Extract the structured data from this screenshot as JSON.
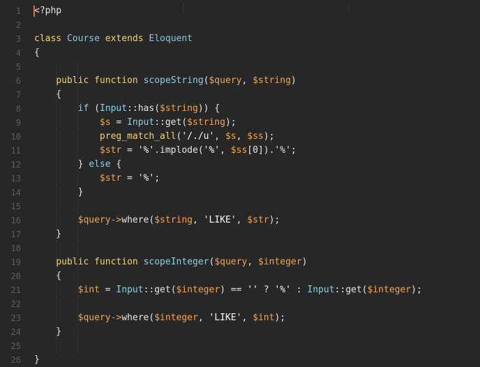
{
  "editor": {
    "language": "php",
    "theme": {
      "background": "#272727",
      "gutter_text": "#5d5d5d",
      "cursor": "#e66a3f"
    },
    "lines": [
      {
        "n": "1",
        "tokens": [
          [
            "tag",
            "<?php"
          ]
        ]
      },
      {
        "n": "2",
        "tokens": []
      },
      {
        "n": "3",
        "tokens": [
          [
            "kw",
            "class"
          ],
          [
            "plain",
            " "
          ],
          [
            "cls",
            "Course"
          ],
          [
            "plain",
            " "
          ],
          [
            "kw",
            "extends"
          ],
          [
            "plain",
            " "
          ],
          [
            "cls",
            "Eloquent"
          ]
        ]
      },
      {
        "n": "4",
        "tokens": [
          [
            "plain",
            "{"
          ]
        ]
      },
      {
        "n": "5",
        "tokens": []
      },
      {
        "n": "6",
        "tokens": [
          [
            "plain",
            "    "
          ],
          [
            "kw",
            "public"
          ],
          [
            "plain",
            " "
          ],
          [
            "kw",
            "function"
          ],
          [
            "plain",
            " "
          ],
          [
            "fn",
            "scopeString"
          ],
          [
            "plain",
            "("
          ],
          [
            "var",
            "$query"
          ],
          [
            "plain",
            ", "
          ],
          [
            "var",
            "$string"
          ],
          [
            "plain",
            ")"
          ]
        ]
      },
      {
        "n": "7",
        "tokens": [
          [
            "plain",
            "    {"
          ]
        ]
      },
      {
        "n": "8",
        "tokens": [
          [
            "plain",
            "        "
          ],
          [
            "ctrl",
            "if"
          ],
          [
            "plain",
            " ("
          ],
          [
            "static",
            "Input"
          ],
          [
            "op",
            "::"
          ],
          [
            "plain",
            "has("
          ],
          [
            "var",
            "$string"
          ],
          [
            "plain",
            ")) {"
          ]
        ]
      },
      {
        "n": "9",
        "tokens": [
          [
            "plain",
            "            "
          ],
          [
            "var",
            "$s"
          ],
          [
            "plain",
            " = "
          ],
          [
            "static",
            "Input"
          ],
          [
            "op",
            "::"
          ],
          [
            "plain",
            "get("
          ],
          [
            "var",
            "$string"
          ],
          [
            "plain",
            ");"
          ]
        ]
      },
      {
        "n": "10",
        "tokens": [
          [
            "plain",
            "            "
          ],
          [
            "kw",
            "preg_match_all"
          ],
          [
            "plain",
            "("
          ],
          [
            "str",
            "'/./u'"
          ],
          [
            "plain",
            ", "
          ],
          [
            "var",
            "$s"
          ],
          [
            "plain",
            ", "
          ],
          [
            "var",
            "$ss"
          ],
          [
            "plain",
            ");"
          ]
        ]
      },
      {
        "n": "11",
        "tokens": [
          [
            "plain",
            "            "
          ],
          [
            "var",
            "$str"
          ],
          [
            "plain",
            " = "
          ],
          [
            "str",
            "'%'"
          ],
          [
            "plain",
            ".implode("
          ],
          [
            "str",
            "'%'"
          ],
          [
            "plain",
            ", "
          ],
          [
            "var",
            "$ss"
          ],
          [
            "plain",
            "[0]).'%';"
          ]
        ]
      },
      {
        "n": "12",
        "tokens": [
          [
            "plain",
            "        } "
          ],
          [
            "ctrl",
            "else"
          ],
          [
            "plain",
            " {"
          ]
        ]
      },
      {
        "n": "13",
        "tokens": [
          [
            "plain",
            "            "
          ],
          [
            "var",
            "$str"
          ],
          [
            "plain",
            " = "
          ],
          [
            "str",
            "'%'"
          ],
          [
            "plain",
            ";"
          ]
        ]
      },
      {
        "n": "14",
        "tokens": [
          [
            "plain",
            "        }"
          ]
        ]
      },
      {
        "n": "15",
        "tokens": []
      },
      {
        "n": "16",
        "tokens": [
          [
            "plain",
            "        "
          ],
          [
            "var",
            "$query"
          ],
          [
            "arrow",
            "->"
          ],
          [
            "plain",
            "where("
          ],
          [
            "var",
            "$string"
          ],
          [
            "plain",
            ", "
          ],
          [
            "str",
            "'LIKE'"
          ],
          [
            "plain",
            ", "
          ],
          [
            "var",
            "$str"
          ],
          [
            "plain",
            ");"
          ]
        ]
      },
      {
        "n": "17",
        "tokens": [
          [
            "plain",
            "    }"
          ]
        ]
      },
      {
        "n": "18",
        "tokens": []
      },
      {
        "n": "19",
        "tokens": [
          [
            "plain",
            "    "
          ],
          [
            "kw",
            "public"
          ],
          [
            "plain",
            " "
          ],
          [
            "kw",
            "function"
          ],
          [
            "plain",
            " "
          ],
          [
            "fn",
            "scopeInteger"
          ],
          [
            "plain",
            "("
          ],
          [
            "var",
            "$query"
          ],
          [
            "plain",
            ", "
          ],
          [
            "var",
            "$integer"
          ],
          [
            "plain",
            ")"
          ]
        ]
      },
      {
        "n": "20",
        "tokens": [
          [
            "plain",
            "    {"
          ]
        ]
      },
      {
        "n": "21",
        "tokens": [
          [
            "plain",
            "        "
          ],
          [
            "var",
            "$int"
          ],
          [
            "plain",
            " = "
          ],
          [
            "static",
            "Input"
          ],
          [
            "op",
            "::"
          ],
          [
            "plain",
            "get("
          ],
          [
            "var",
            "$integer"
          ],
          [
            "plain",
            ") == "
          ],
          [
            "str",
            "''"
          ],
          [
            "plain",
            " ? "
          ],
          [
            "str",
            "'%'"
          ],
          [
            "plain",
            " : "
          ],
          [
            "static",
            "Input"
          ],
          [
            "op",
            "::"
          ],
          [
            "plain",
            "get("
          ],
          [
            "var",
            "$integer"
          ],
          [
            "plain",
            ");"
          ]
        ]
      },
      {
        "n": "22",
        "tokens": []
      },
      {
        "n": "23",
        "tokens": [
          [
            "plain",
            "        "
          ],
          [
            "var",
            "$query"
          ],
          [
            "arrow",
            "->"
          ],
          [
            "plain",
            "where("
          ],
          [
            "var",
            "$integer"
          ],
          [
            "plain",
            ", "
          ],
          [
            "str",
            "'LIKE'"
          ],
          [
            "plain",
            ", "
          ],
          [
            "var",
            "$int"
          ],
          [
            "plain",
            ");"
          ]
        ]
      },
      {
        "n": "24",
        "tokens": [
          [
            "plain",
            "    }"
          ]
        ]
      },
      {
        "n": "25",
        "tokens": []
      },
      {
        "n": "26",
        "tokens": [
          [
            "plain",
            "}"
          ]
        ]
      }
    ]
  }
}
